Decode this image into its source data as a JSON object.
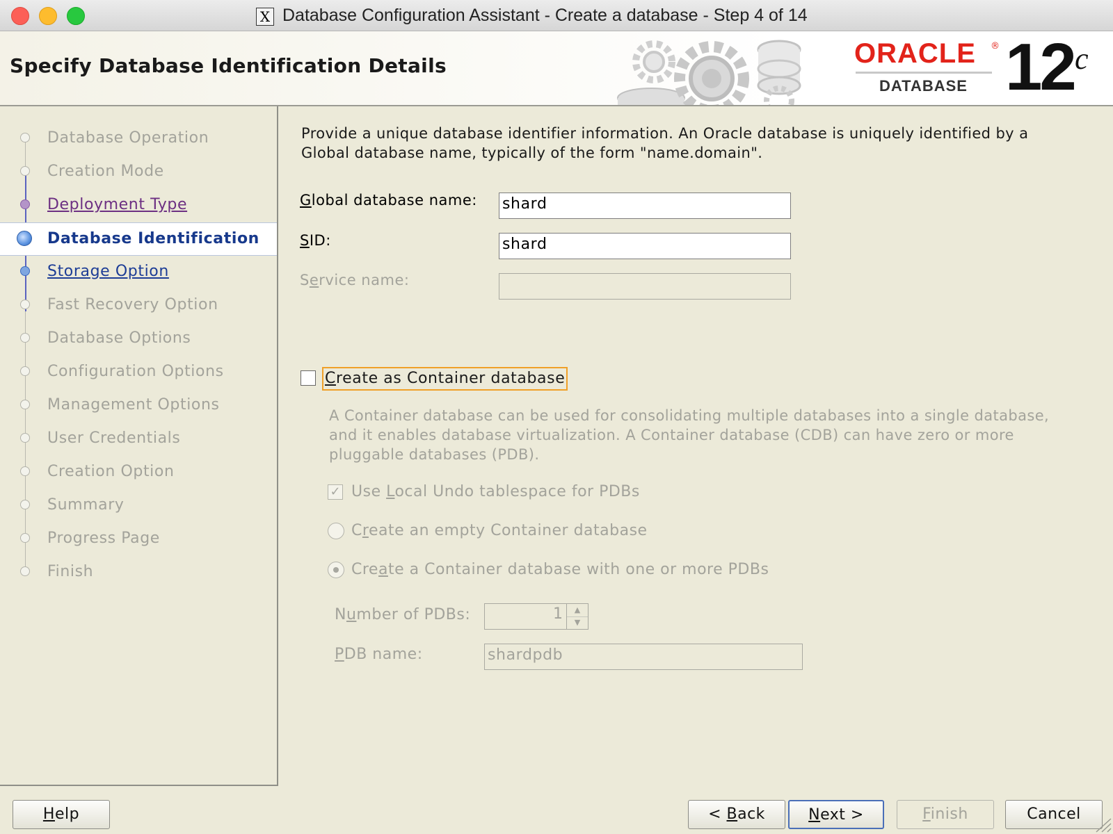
{
  "window": {
    "title": "Database Configuration Assistant - Create a database - Step 4 of 14",
    "x_icon": "X"
  },
  "header": {
    "page_title": "Specify Database Identification Details",
    "logo": {
      "brand": "ORACLE",
      "registered": "®",
      "product": "DATABASE",
      "version": "12",
      "version_suffix": "c"
    }
  },
  "steps": [
    {
      "label": "Database Operation",
      "state": "inactive"
    },
    {
      "label": "Creation Mode",
      "state": "inactive"
    },
    {
      "label": "Deployment Type",
      "state": "visited"
    },
    {
      "label": "Database Identification",
      "state": "current"
    },
    {
      "label": "Storage Option",
      "state": "next"
    },
    {
      "label": "Fast Recovery Option",
      "state": "inactive"
    },
    {
      "label": "Database Options",
      "state": "inactive"
    },
    {
      "label": "Configuration Options",
      "state": "inactive"
    },
    {
      "label": "Management Options",
      "state": "inactive"
    },
    {
      "label": "User Credentials",
      "state": "inactive"
    },
    {
      "label": "Creation Option",
      "state": "inactive"
    },
    {
      "label": "Summary",
      "state": "inactive"
    },
    {
      "label": "Progress Page",
      "state": "inactive"
    },
    {
      "label": "Finish",
      "state": "inactive"
    }
  ],
  "main": {
    "intro_line1": "Provide a unique database identifier information. An Oracle database is uniquely identified by a",
    "intro_line2": "Global database name, typically of the form \"name.domain\".",
    "global_db_name": {
      "label_u": "G",
      "label_rest": "lobal database name:",
      "value": "shard"
    },
    "sid": {
      "label_u": "S",
      "label_rest": "ID:",
      "value": "shard"
    },
    "service_name": {
      "label_pre": "S",
      "label_u": "e",
      "label_rest": "rvice name:",
      "value": ""
    },
    "container": {
      "label_u": "C",
      "label_rest": "reate as Container database",
      "checked": false,
      "desc_line1": "A Container database can be used for consolidating multiple databases into a single database,",
      "desc_line2": "and it enables database virtualization. A Container database (CDB) can have zero or more",
      "desc_line3": "pluggable databases (PDB).",
      "local_undo": {
        "label_pre": "Use ",
        "label_u": "L",
        "label_rest": "ocal Undo tablespace for PDBs",
        "checked": true
      },
      "empty_cdb": {
        "label_pre": "C",
        "label_u": "r",
        "label_rest": "eate an empty Container database",
        "selected": false
      },
      "with_pdbs": {
        "label_pre": "Cre",
        "label_u": "a",
        "label_rest": "te a Container database with one or more PDBs",
        "selected": true
      },
      "num_pdbs": {
        "label_pre": "N",
        "label_u": "u",
        "label_rest": "mber of PDBs:",
        "value": "1"
      },
      "pdb_name": {
        "label_u": "P",
        "label_rest": "DB name:",
        "value": "shardpdb"
      }
    }
  },
  "footer": {
    "help": {
      "u": "H",
      "rest": "elp"
    },
    "back": {
      "pre": "< ",
      "u": "B",
      "rest": "ack"
    },
    "next": {
      "u": "N",
      "rest": "ext >"
    },
    "finish": {
      "u": "F",
      "rest": "inish"
    },
    "cancel": "Cancel"
  },
  "colors": {
    "background": "#ecead9",
    "current_step": "#17398c",
    "visited_step": "#6c2f82",
    "next_step": "#1d3d96",
    "focus_ring": "#f0a028",
    "oracle_red": "#e2231a"
  }
}
